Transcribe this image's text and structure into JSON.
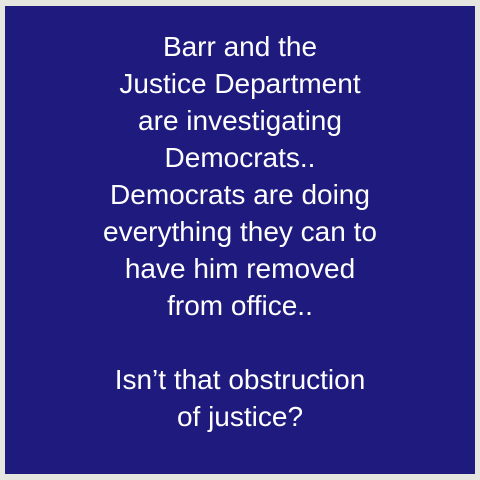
{
  "meme": {
    "paragraph1": [
      "Barr and the",
      "Justice Department",
      "are investigating",
      "Democrats..",
      "Democrats are doing",
      "everything they can to",
      "have him removed",
      "from office.."
    ],
    "paragraph2": [
      "Isn’t that obstruction",
      "of justice?"
    ]
  },
  "colors": {
    "background": "#1f1a7e",
    "text": "#ffffff",
    "border": "#e6e6e1"
  }
}
